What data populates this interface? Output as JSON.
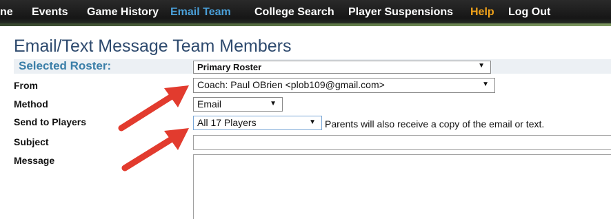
{
  "nav": {
    "items": [
      {
        "label": "ne"
      },
      {
        "label": "Events"
      },
      {
        "label": "Game History"
      },
      {
        "label": "Email Team"
      },
      {
        "label": "College Search"
      },
      {
        "label": "Player Suspensions"
      },
      {
        "label": "Help"
      },
      {
        "label": "Log Out"
      }
    ],
    "active_item": "Email Team",
    "accent_color": "#4a9fd8",
    "help_color": "#f0a21a"
  },
  "page": {
    "title": "Email/Text Message Team Members"
  },
  "form": {
    "selected_roster_label": "Selected Roster:",
    "selected_roster_value": "Primary Roster",
    "from_label": "From",
    "from_value": "Coach: Paul OBrien <plob109@gmail.com>",
    "method_label": "Method",
    "method_value": "Email",
    "send_to_label": "Send to Players",
    "send_to_value": "All 17 Players",
    "send_to_note": "Parents will also receive a copy of the email or text.",
    "subject_label": "Subject",
    "subject_value": "",
    "message_label": "Message",
    "message_value": ""
  },
  "annotations": {
    "arrow_color": "#e23b2e",
    "arrow_count": 2
  }
}
